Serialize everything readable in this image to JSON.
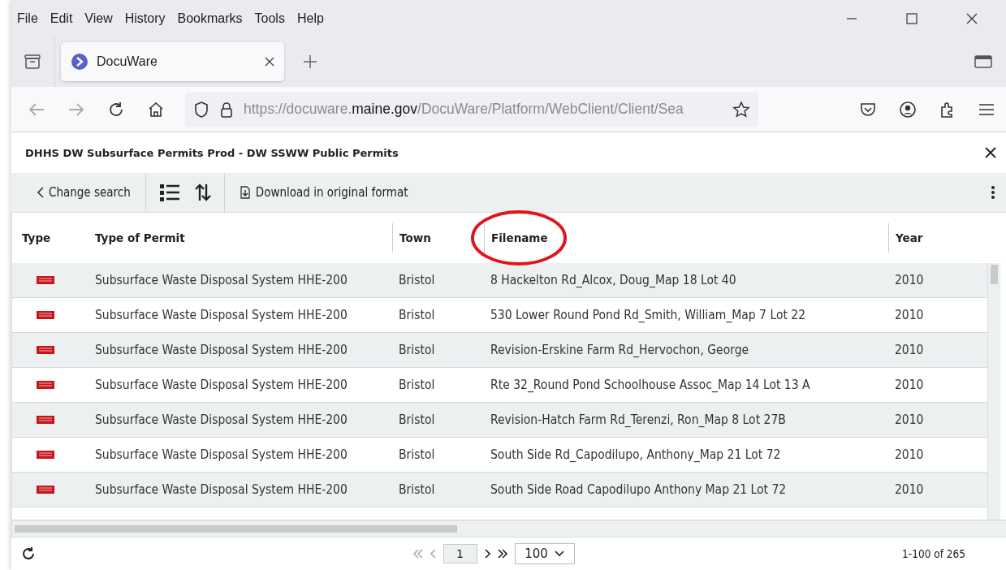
{
  "menu": [
    "File",
    "Edit",
    "View",
    "History",
    "Bookmarks",
    "Tools",
    "Help"
  ],
  "tabs": [
    {
      "label": "DocuWare",
      "selected": true
    }
  ],
  "address": {
    "prefix": "https://docuware.",
    "domain": "maine.gov",
    "path": "/DocuWare/Platform/WebClient/Client/Sea"
  },
  "dialog": {
    "title": "DHHS DW Subsurface Permits Prod - DW SSWW Public Permits"
  },
  "toolbar": {
    "change_search": "Change search",
    "download": "Download in original format"
  },
  "table": {
    "columns": [
      {
        "label": "Type",
        "highlighted": false
      },
      {
        "label": "Type of Permit",
        "highlighted": false
      },
      {
        "label": "Town",
        "highlighted": false
      },
      {
        "label": "Filename",
        "highlighted": true
      },
      {
        "label": "Year",
        "highlighted": false
      }
    ],
    "rows": [
      {
        "kind": "pdf",
        "permit": "Subsurface Waste Disposal System HHE-200",
        "town": "Bristol",
        "filename": "8 Hackelton Rd_Alcox, Doug_Map 18 Lot 40",
        "year": "2010"
      },
      {
        "kind": "pdf",
        "permit": "Subsurface Waste Disposal System HHE-200",
        "town": "Bristol",
        "filename": "530 Lower Round Pond Rd_Smith, William_Map 7 Lot 22",
        "year": "2010"
      },
      {
        "kind": "pdf",
        "permit": "Subsurface Waste Disposal System HHE-200",
        "town": "Bristol",
        "filename": "Revision-Erskine Farm Rd_Hervochon, George",
        "year": "2010"
      },
      {
        "kind": "pdf",
        "permit": "Subsurface Waste Disposal System HHE-200",
        "town": "Bristol",
        "filename": "Rte 32_Round Pond Schoolhouse Assoc_Map 14 Lot 13 A",
        "year": "2010"
      },
      {
        "kind": "pdf",
        "permit": "Subsurface Waste Disposal System HHE-200",
        "town": "Bristol",
        "filename": "Revision-Hatch Farm Rd_Terenzi, Ron_Map 8 Lot 27B",
        "year": "2010"
      },
      {
        "kind": "pdf",
        "permit": "Subsurface Waste Disposal System HHE-200",
        "town": "Bristol",
        "filename": "South Side Rd_Capodilupo, Anthony_Map 21 Lot 72",
        "year": "2010"
      },
      {
        "kind": "pdf",
        "permit": "Subsurface Waste Disposal System HHE-200",
        "town": "Bristol",
        "filename": "South Side Road Capodilupo Anthony Map 21 Lot 72",
        "year": "2010"
      }
    ]
  },
  "pager": {
    "page": "1",
    "page_size": "100",
    "count": "1-100 of 265"
  }
}
